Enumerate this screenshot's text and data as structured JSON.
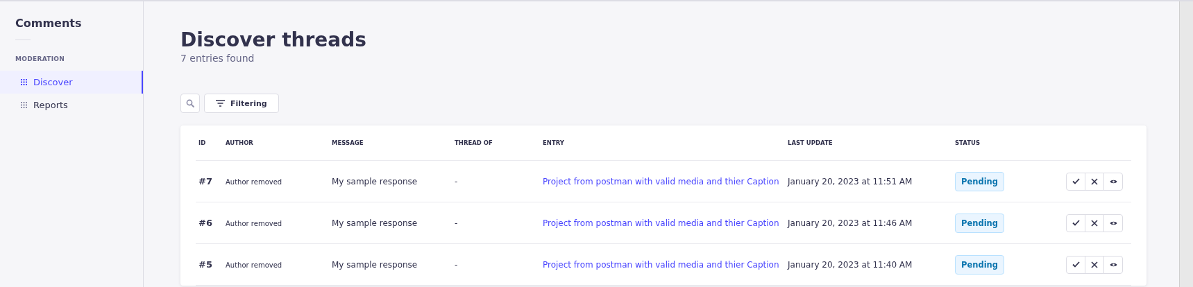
{
  "sidebar": {
    "title": "Comments",
    "section": "MODERATION",
    "items": [
      {
        "label": "Discover",
        "selected": true
      },
      {
        "label": "Reports",
        "selected": false
      }
    ]
  },
  "header": {
    "title": "Discover threads",
    "subtitle": "7 entries found"
  },
  "toolbar": {
    "filter_button": "Filtering"
  },
  "table": {
    "columns": [
      "ID",
      "AUTHOR",
      "MESSAGE",
      "THREAD OF",
      "ENTRY",
      "LAST UPDATE",
      "STATUS"
    ],
    "rows": [
      {
        "id": "#7",
        "author": "Author removed",
        "message": "My sample response",
        "thread_of": "-",
        "entry": "Project from postman with valid media and thier Caption",
        "last_update": "January 20, 2023 at 11:51 AM",
        "status": "Pending"
      },
      {
        "id": "#6",
        "author": "Author removed",
        "message": "My sample response",
        "thread_of": "-",
        "entry": "Project from postman with valid media and thier Caption",
        "last_update": "January 20, 2023 at 11:46 AM",
        "status": "Pending"
      },
      {
        "id": "#5",
        "author": "Author removed",
        "message": "My sample response",
        "thread_of": "-",
        "entry": "Project from postman with valid media and thier Caption",
        "last_update": "January 20, 2023 at 11:40 AM",
        "status": "Pending"
      }
    ]
  }
}
